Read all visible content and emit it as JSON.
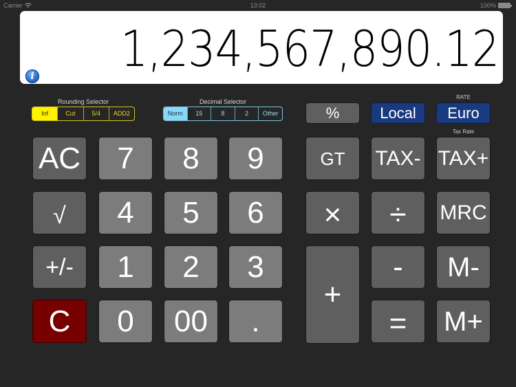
{
  "status_bar": {
    "carrier": "Carrier",
    "wifi_icon": "wifi-icon",
    "time": "13:02",
    "battery": "100%",
    "battery_icon": "battery-icon"
  },
  "display": {
    "value": "1,234,567,890.12",
    "info_icon": "i"
  },
  "rounding_selector": {
    "label": "Rounding Selector",
    "options": [
      "Inf",
      "Cut",
      "5/4",
      "ADD2"
    ],
    "selected": "Inf",
    "accent_color": "#fff200"
  },
  "decimal_selector": {
    "label": "Decimal Selector",
    "options": [
      "Norm",
      "15",
      "8",
      "2",
      "Other"
    ],
    "selected": "Norm",
    "accent_color": "#8ad8f8"
  },
  "top_keys": {
    "percent": "%",
    "local": "Local",
    "rate_label": "RATE",
    "euro": "Euro",
    "tax_rate_label": "Tax Rate"
  },
  "keys": {
    "ac": "AC",
    "seven": "7",
    "eight": "8",
    "nine": "9",
    "gt": "GT",
    "tax_minus": "TAX-",
    "tax_plus": "TAX+",
    "sqrt": "√",
    "four": "4",
    "five": "5",
    "six": "6",
    "multiply": "×",
    "divide": "÷",
    "mrc": "MRC",
    "plus_minus": "+/-",
    "one": "1",
    "two": "2",
    "three": "3",
    "plus": "+",
    "minus": "-",
    "m_minus": "M-",
    "clear": "C",
    "zero": "0",
    "double_zero": "00",
    "decimal": ".",
    "equals": "=",
    "m_plus": "M+"
  },
  "colors": {
    "background": "#262626",
    "digit_key": "#7c7c7c",
    "function_key": "#5f5f5f",
    "clear_key": "#770000",
    "currency_key": "#1a3a80"
  }
}
